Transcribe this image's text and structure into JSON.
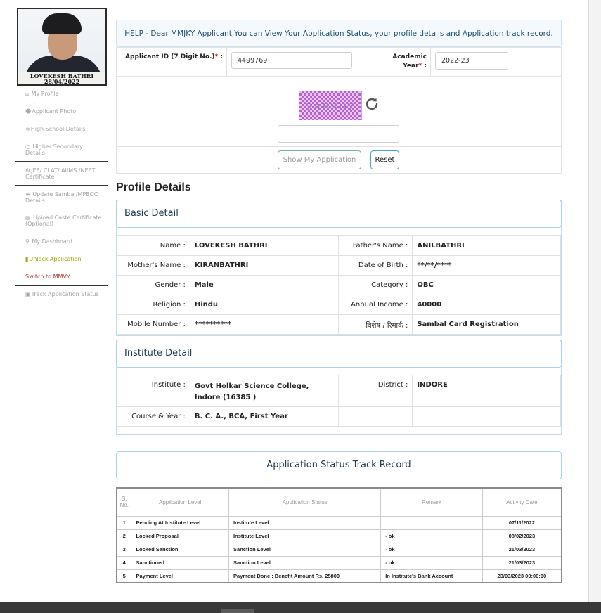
{
  "profile_photo": {
    "caption_name": "LOVEKESH BATHRI",
    "caption_date": "28/04/2022"
  },
  "sidebar": {
    "items": [
      {
        "icon": "home-icon",
        "label": "My Profile"
      },
      {
        "icon": "user-icon",
        "label": "Applicant Photo"
      },
      {
        "icon": "list-icon",
        "label": "High School Details"
      },
      {
        "icon": "circle-icon",
        "label": "Higher Secondary Details"
      },
      {
        "icon": "gears-icon",
        "label": "JEE/ CLAT/ AIIMS /NEET Certificate"
      },
      {
        "icon": "list-icon",
        "label": "Update Sambal/MPBOC Details"
      },
      {
        "icon": "file-icon",
        "label": "Upload Caste Certificate (Optional)"
      },
      {
        "icon": "search-icon",
        "label": "My Dashboard"
      },
      {
        "icon": "unlock-icon",
        "label": "Unlock Application"
      },
      {
        "icon": "",
        "label": "Switch to MMVY"
      },
      {
        "icon": "truck-icon",
        "label": "Track Application Status"
      }
    ]
  },
  "help": {
    "text": "HELP - Dear MMJKY Applicant,You can View Your Application Status, your profile details and Application track record."
  },
  "form": {
    "applicant_id_label": "Applicant ID (7 Digit No.)",
    "required_mark": "*",
    "label_colon": " :",
    "applicant_id_value": "4499769",
    "academic_year_label_1": "Academic",
    "academic_year_label_2": "Year",
    "academic_year_value": "2022-23",
    "captcha_text": "2ABSD7",
    "captcha_input_value": "",
    "show_button": "Show My Application",
    "reset_button": "Reset"
  },
  "profile": {
    "heading": "Profile Details",
    "basic_heading": "Basic Detail",
    "basic": [
      {
        "k1": "Name :",
        "v1": "LOVEKESH BATHRI",
        "k2": "Father's Name :",
        "v2": "ANILBATHRI"
      },
      {
        "k1": "Mother's Name :",
        "v1": "KIRANBATHRI",
        "k2": "Date of Birth :",
        "v2": "**/**/****"
      },
      {
        "k1": "Gender :",
        "v1": "Male",
        "k2": "Category :",
        "v2": "OBC"
      },
      {
        "k1": "Religion :",
        "v1": "Hindu",
        "k2": "Annual Income :",
        "v2": "40000"
      },
      {
        "k1": "Mobile Number :",
        "v1": "**********",
        "k2": "विशेष / रिमार्क :",
        "v2": "Sambal Card Registration"
      }
    ],
    "institute_heading": "Institute Detail",
    "institute": {
      "institute_label": "Institute :",
      "institute_value": "Govt Holkar Science College, Indore (16385 )",
      "district_label": "District :",
      "district_value": "INDORE",
      "course_label": "Course & Year :",
      "course_value": "B. C. A., BCA, First Year"
    }
  },
  "track": {
    "heading": "Application Status Track Record",
    "columns": [
      "S. No.",
      "Application Level",
      "Application Status",
      "Remark",
      "Activity Date"
    ],
    "rows": [
      {
        "sno": "1",
        "level": "Pending At Institute Level",
        "status": "Institute Level",
        "remark": "",
        "date": "07/11/2022"
      },
      {
        "sno": "2",
        "level": "Locked Proposal",
        "status": "Institute Level",
        "remark": "- ok",
        "date": "08/02/2023"
      },
      {
        "sno": "3",
        "level": "Locked Sanction",
        "status": "Sanction Level",
        "remark": "- ok",
        "date": "21/03/2023"
      },
      {
        "sno": "4",
        "level": "Sanctioned",
        "status": "Sanction Level",
        "remark": "- ok",
        "date": "21/03/2023"
      },
      {
        "sno": "5",
        "level": "Payment Level",
        "status": "Payment Done : Benefit Amount Rs. 25800",
        "remark": "In Institute's Bank Account",
        "date": "23/03/2023 00:00:00"
      }
    ]
  }
}
